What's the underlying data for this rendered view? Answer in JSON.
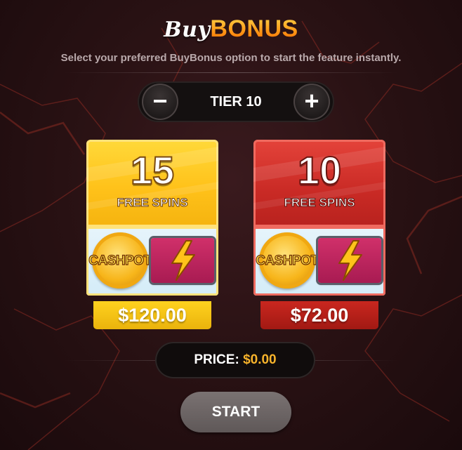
{
  "header": {
    "title_buy": "Buy",
    "title_bonus": "BONUS",
    "subtitle": "Select your preferred BuyBonus option to start the feature instantly."
  },
  "tier": {
    "minus_label": "−",
    "plus_label": "+",
    "label": "TIER 10"
  },
  "options": [
    {
      "spins": "15",
      "spins_label": "FREE SPINS",
      "coin_text": "CASHPOT",
      "price": "$120.00",
      "color": "#ffc21a"
    },
    {
      "spins": "10",
      "spins_label": "FREE SPINS",
      "coin_text": "CASHPOT",
      "price": "$72.00",
      "color": "#c92a25"
    }
  ],
  "price_bar": {
    "label": "PRICE:",
    "value": "$0.00"
  },
  "start_label": "START",
  "colors": {
    "accent_orange": "#ff8a1a",
    "price_value": "#f7b32b",
    "background": "#2a1214"
  },
  "icons": {
    "bolt": "lightning-bolt-icon",
    "coin": "cashpot-coin-icon"
  }
}
